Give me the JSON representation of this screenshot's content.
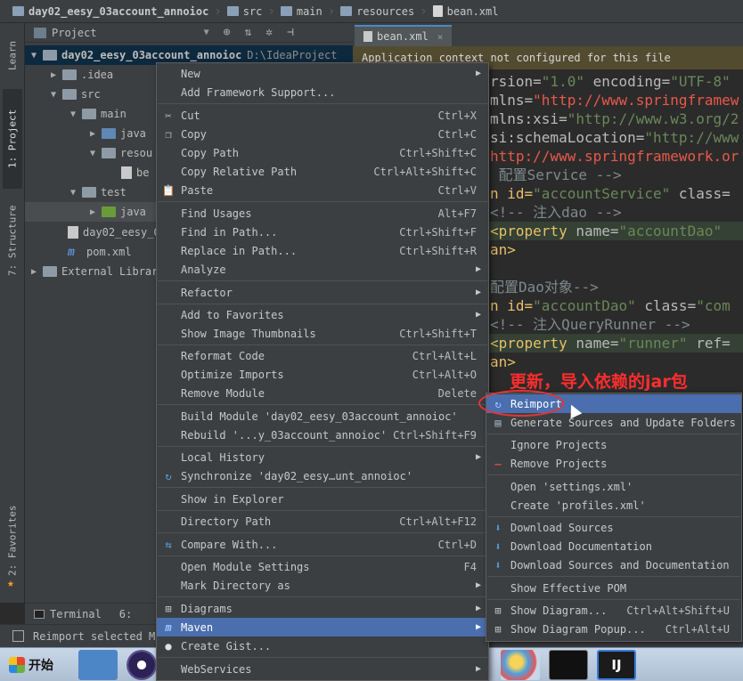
{
  "breadcrumb": {
    "project": "day02_eesy_03account_annoioc",
    "parts": [
      "src",
      "main",
      "resources",
      "bean.xml"
    ]
  },
  "gutter": {
    "learn": "Learn",
    "project": "1: Project",
    "structure": "7: Structure",
    "favorites": "2: Favorites"
  },
  "project_panel": {
    "title": "Project",
    "tree": [
      {
        "label": "day02_eesy_03account_annoioc",
        "path": "D:\\IdeaProject"
      },
      {
        "label": ".idea"
      },
      {
        "label": "src"
      },
      {
        "label": "main"
      },
      {
        "label": "java"
      },
      {
        "label": "resou"
      },
      {
        "label": "be"
      },
      {
        "label": "test"
      },
      {
        "label": "java"
      },
      {
        "label": "day02_eesy_0"
      },
      {
        "label": "pom.xml"
      },
      {
        "label": "External Librar"
      }
    ]
  },
  "editor": {
    "tab": "bean.xml",
    "banner": "Application context not configured for this file",
    "lines": {
      "l1a": "rsion=",
      "l1b": "\"1.0\"",
      "l1c": " encoding=",
      "l1d": "\"UTF-8\"",
      "l2a": "mlns=",
      "l2b": "\"http://www.springframew",
      "l3a": "mlns:xsi=",
      "l3b": "\"http://www.w3.org/2",
      "l4a": "si:schemaLocation=",
      "l4b": "\"http://www",
      "l5": "http://www.springframework.or",
      "l6": " 配置Service -->",
      "l7a": "n id=",
      "l7b": "\"accountService\"",
      "l7c": " class=",
      "l8": "<!-- 注入dao -->",
      "l9a": "<property ",
      "l9b": "name=",
      "l9c": "\"accountDao\"",
      "l10": "an>",
      "l11": "配置Dao对象-->",
      "l12a": "n id=",
      "l12b": "\"accountDao\"",
      "l12c": " class=",
      "l12d": "\"com",
      "l13": "<!-- 注入QueryRunner -->",
      "l14a": "<property ",
      "l14b": "name=",
      "l14c": "\"runner\"",
      "l14d": " ref=",
      "l15": "an>"
    },
    "annotation": "更新，导入依赖的jar包"
  },
  "context_menu": {
    "items": [
      {
        "label": "New",
        "shortcut": "",
        "arrow": "▶"
      },
      {
        "label": "Add Framework Support...",
        "shortcut": ""
      },
      {
        "label": "Cut",
        "shortcut": "Ctrl+X"
      },
      {
        "label": "Copy",
        "shortcut": "Ctrl+C"
      },
      {
        "label": "Copy Path",
        "shortcut": "Ctrl+Shift+C"
      },
      {
        "label": "Copy Relative Path",
        "shortcut": "Ctrl+Alt+Shift+C"
      },
      {
        "label": "Paste",
        "shortcut": "Ctrl+V"
      },
      {
        "label": "Find Usages",
        "shortcut": "Alt+F7"
      },
      {
        "label": "Find in Path...",
        "shortcut": "Ctrl+Shift+F"
      },
      {
        "label": "Replace in Path...",
        "shortcut": "Ctrl+Shift+R"
      },
      {
        "label": "Analyze",
        "shortcut": "",
        "arrow": "▶"
      },
      {
        "label": "Refactor",
        "shortcut": "",
        "arrow": "▶"
      },
      {
        "label": "Add to Favorites",
        "shortcut": "",
        "arrow": "▶"
      },
      {
        "label": "Show Image Thumbnails",
        "shortcut": "Ctrl+Shift+T"
      },
      {
        "label": "Reformat Code",
        "shortcut": "Ctrl+Alt+L"
      },
      {
        "label": "Optimize Imports",
        "shortcut": "Ctrl+Alt+O"
      },
      {
        "label": "Remove Module",
        "shortcut": "Delete"
      },
      {
        "label": "Build Module 'day02_eesy_03account_annoioc'",
        "shortcut": ""
      },
      {
        "label": "Rebuild '...y_03account_annoioc'",
        "shortcut": "Ctrl+Shift+F9"
      },
      {
        "label": "Local History",
        "shortcut": "",
        "arrow": "▶"
      },
      {
        "label": "Synchronize 'day02_eesy…unt_annoioc'",
        "shortcut": ""
      },
      {
        "label": "Show in Explorer",
        "shortcut": ""
      },
      {
        "label": "Directory Path",
        "shortcut": "Ctrl+Alt+F12"
      },
      {
        "label": "Compare With...",
        "shortcut": "Ctrl+D"
      },
      {
        "label": "Open Module Settings",
        "shortcut": "F4"
      },
      {
        "label": "Mark Directory as",
        "shortcut": "",
        "arrow": "▶"
      },
      {
        "label": "Diagrams",
        "shortcut": "",
        "arrow": "▶"
      },
      {
        "label": "Maven",
        "shortcut": "",
        "arrow": "▶"
      },
      {
        "label": "Create Gist...",
        "shortcut": ""
      },
      {
        "label": "WebServices",
        "shortcut": "",
        "arrow": "▶"
      }
    ]
  },
  "maven_menu": {
    "items": [
      {
        "label": "Reimport",
        "shortcut": ""
      },
      {
        "label": "Generate Sources and Update Folders",
        "shortcut": ""
      },
      {
        "label": "Ignore Projects",
        "shortcut": ""
      },
      {
        "label": "Remove Projects",
        "shortcut": ""
      },
      {
        "label": "Open 'settings.xml'",
        "shortcut": ""
      },
      {
        "label": "Create 'profiles.xml'",
        "shortcut": ""
      },
      {
        "label": "Download Sources",
        "shortcut": ""
      },
      {
        "label": "Download Documentation",
        "shortcut": ""
      },
      {
        "label": "Download Sources and Documentation",
        "shortcut": ""
      },
      {
        "label": "Show Effective POM",
        "shortcut": ""
      },
      {
        "label": "Show Diagram...",
        "shortcut": "Ctrl+Alt+Shift+U"
      },
      {
        "label": "Show Diagram Popup...",
        "shortcut": "Ctrl+Alt+U"
      }
    ]
  },
  "bottom": {
    "terminal": "Terminal",
    "tool6": "6:",
    "status": "Reimport selected Mav"
  },
  "taskbar": {
    "start": "开始"
  },
  "colors": {
    "accent": "#4b6eaf",
    "annotation": "#ff2d2d"
  }
}
